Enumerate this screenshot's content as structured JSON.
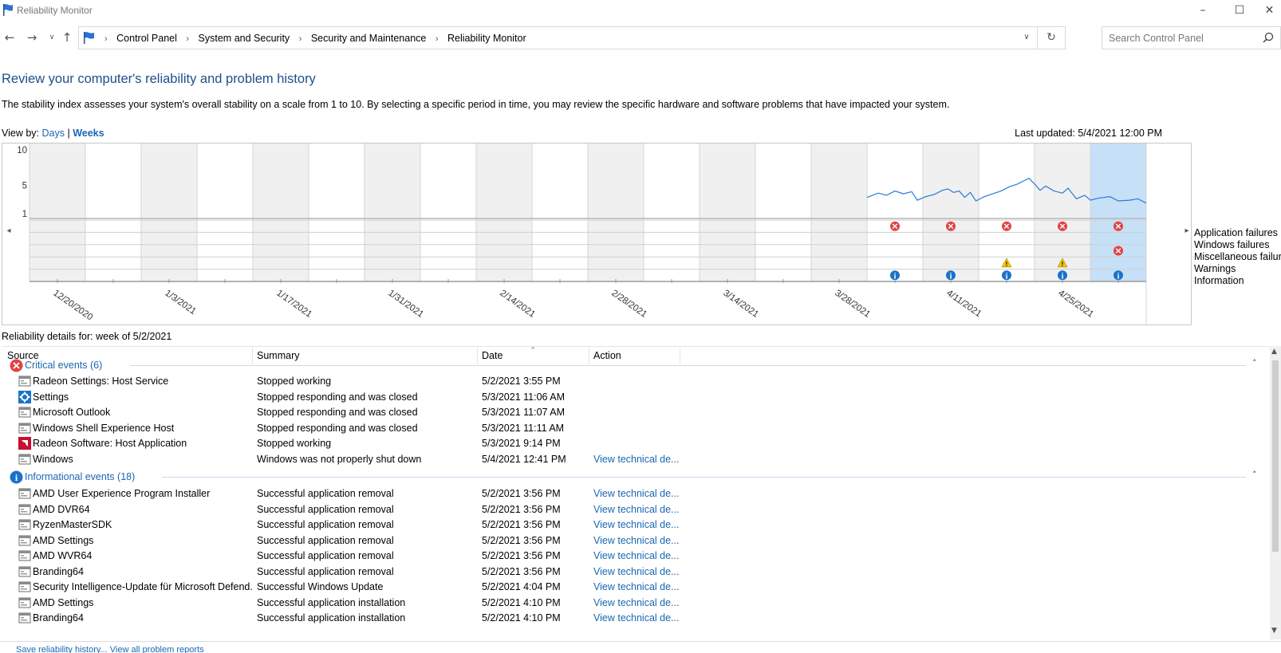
{
  "window": {
    "title": "Reliability Monitor"
  },
  "nav": {
    "breadcrumb": [
      "Control Panel",
      "System and Security",
      "Security and Maintenance",
      "Reliability Monitor"
    ],
    "search_placeholder": "Search Control Panel"
  },
  "header": {
    "title": "Review your computer's reliability and problem history",
    "description": "The stability index assesses your system's overall stability on a scale from 1 to 10. By selecting a specific period in time, you may review the specific hardware and software problems that have impacted your system.",
    "view_by_label": "View by:",
    "view_days": "Days",
    "view_separator": "|",
    "view_weeks": "Weeks",
    "last_updated": "Last updated: 5/4/2021 12:00 PM"
  },
  "chart": {
    "y_ticks": [
      "10",
      "5",
      "1"
    ],
    "dates": [
      "12/20/2020",
      "1/3/2021",
      "1/17/2021",
      "1/31/2021",
      "2/14/2021",
      "2/28/2021",
      "3/14/2021",
      "3/28/2021",
      "4/11/2021",
      "4/25/2021"
    ],
    "row_labels": [
      "Application failures",
      "Windows failures",
      "Miscellaneous failures",
      "Warnings",
      "Information"
    ],
    "columns": 20,
    "selected_column": 19,
    "stability_series": [
      [
        15,
        3.3
      ],
      [
        15.2,
        3.9
      ],
      [
        15.35,
        3.6
      ],
      [
        15.5,
        4.2
      ],
      [
        15.65,
        3.8
      ],
      [
        15.8,
        4.1
      ],
      [
        15.9,
        2.9
      ],
      [
        16.05,
        3.4
      ],
      [
        16.2,
        3.7
      ],
      [
        16.35,
        4.3
      ],
      [
        16.45,
        4.5
      ],
      [
        16.55,
        4.0
      ],
      [
        16.65,
        4.2
      ],
      [
        16.75,
        3.3
      ],
      [
        16.85,
        4.0
      ],
      [
        16.95,
        2.8
      ],
      [
        17.1,
        3.4
      ],
      [
        17.25,
        3.8
      ],
      [
        17.4,
        4.2
      ],
      [
        17.55,
        4.8
      ],
      [
        17.7,
        5.2
      ],
      [
        17.8,
        5.6
      ],
      [
        17.9,
        6.0
      ],
      [
        18.0,
        5.2
      ],
      [
        18.1,
        4.3
      ],
      [
        18.2,
        4.9
      ],
      [
        18.35,
        4.2
      ],
      [
        18.5,
        3.9
      ],
      [
        18.6,
        4.6
      ],
      [
        18.75,
        3.1
      ],
      [
        18.9,
        3.6
      ],
      [
        19.0,
        2.9
      ],
      [
        19.15,
        3.2
      ],
      [
        19.35,
        3.4
      ],
      [
        19.5,
        2.8
      ],
      [
        19.7,
        2.9
      ],
      [
        19.85,
        3.1
      ],
      [
        20.0,
        2.5
      ]
    ],
    "events": {
      "application_failures": [
        15,
        16,
        17,
        18,
        19
      ],
      "windows_failures": [],
      "miscellaneous_failures": [
        19
      ],
      "warnings": [
        17,
        18
      ],
      "information": [
        15,
        16,
        17,
        18,
        19
      ]
    },
    "colors": {
      "line": "#2b7bd3",
      "selected": "#c6e0f7",
      "shade": "#f0f0f0",
      "error": "#e04343",
      "warning": "#f2c200",
      "info": "#1a73c8"
    }
  },
  "details": {
    "label": "Reliability details for: week of 5/2/2021",
    "columns": [
      "Source",
      "Summary",
      "Date",
      "Action"
    ],
    "critical": {
      "label": "Critical events (6)",
      "rows": [
        {
          "icon": "app-window-icon",
          "source": "Radeon Settings: Host Service",
          "summary": "Stopped working",
          "date": "5/2/2021 3:55 PM",
          "action": ""
        },
        {
          "icon": "settings-gear-icon",
          "source": "Settings",
          "summary": "Stopped responding and was closed",
          "date": "5/3/2021 11:06 AM",
          "action": ""
        },
        {
          "icon": "app-window-icon",
          "source": "Microsoft Outlook",
          "summary": "Stopped responding and was closed",
          "date": "5/3/2021 11:07 AM",
          "action": ""
        },
        {
          "icon": "app-window-icon",
          "source": "Windows Shell Experience Host",
          "summary": "Stopped responding and was closed",
          "date": "5/3/2021 11:11 AM",
          "action": ""
        },
        {
          "icon": "radeon-icon",
          "source": "Radeon Software: Host Application",
          "summary": "Stopped working",
          "date": "5/3/2021 9:14 PM",
          "action": ""
        },
        {
          "icon": "app-window-icon",
          "source": "Windows",
          "summary": "Windows was not properly shut down",
          "date": "5/4/2021 12:41 PM",
          "action": "View technical de..."
        }
      ]
    },
    "informational": {
      "label": "Informational events (18)",
      "rows": [
        {
          "icon": "app-window-icon",
          "source": "AMD User Experience Program Installer",
          "summary": "Successful application removal",
          "date": "5/2/2021 3:56 PM",
          "action": "View technical de..."
        },
        {
          "icon": "app-window-icon",
          "source": "AMD DVR64",
          "summary": "Successful application removal",
          "date": "5/2/2021 3:56 PM",
          "action": "View technical de..."
        },
        {
          "icon": "app-window-icon",
          "source": "RyzenMasterSDK",
          "summary": "Successful application removal",
          "date": "5/2/2021 3:56 PM",
          "action": "View technical de..."
        },
        {
          "icon": "app-window-icon",
          "source": "AMD Settings",
          "summary": "Successful application removal",
          "date": "5/2/2021 3:56 PM",
          "action": "View technical de..."
        },
        {
          "icon": "app-window-icon",
          "source": "AMD WVR64",
          "summary": "Successful application removal",
          "date": "5/2/2021 3:56 PM",
          "action": "View technical de..."
        },
        {
          "icon": "app-window-icon",
          "source": "Branding64",
          "summary": "Successful application removal",
          "date": "5/2/2021 3:56 PM",
          "action": "View technical de..."
        },
        {
          "icon": "app-window-icon",
          "source": "Security Intelligence-Update für Microsoft Defend...",
          "summary": "Successful Windows Update",
          "date": "5/2/2021 4:04 PM",
          "action": "View technical de..."
        },
        {
          "icon": "app-window-icon",
          "source": "AMD Settings",
          "summary": "Successful application installation",
          "date": "5/2/2021 4:10 PM",
          "action": "View technical de..."
        },
        {
          "icon": "app-window-icon",
          "source": "Branding64",
          "summary": "Successful application installation",
          "date": "5/2/2021 4:10 PM",
          "action": "View technical de..."
        }
      ]
    }
  },
  "footer": {
    "link": "Save reliability history...   View all problem reports"
  }
}
